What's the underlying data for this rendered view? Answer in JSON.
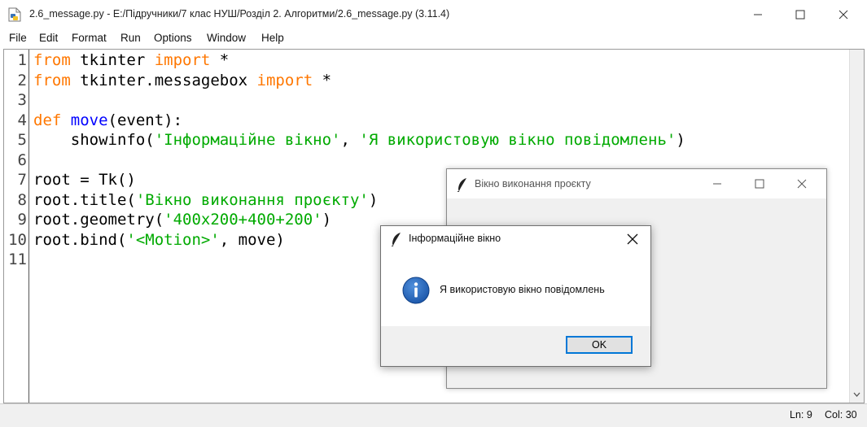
{
  "window": {
    "title": "2.6_message.py - E:/Підручники/7 клас НУШ/Розділ 2. Алгоритми/2.6_message.py (3.11.4)"
  },
  "menu": [
    "File",
    "Edit",
    "Format",
    "Run",
    "Options",
    "Window",
    "Help"
  ],
  "editor": {
    "line_numbers": [
      "1",
      "2",
      "3",
      "4",
      "5",
      "6",
      "7",
      "8",
      "9",
      "10",
      "11"
    ],
    "lines": [
      [
        {
          "t": "from",
          "c": "kw"
        },
        {
          "t": " tkinter ",
          "c": ""
        },
        {
          "t": "import",
          "c": "kw"
        },
        {
          "t": " *",
          "c": ""
        }
      ],
      [
        {
          "t": "from",
          "c": "kw"
        },
        {
          "t": " tkinter.messagebox ",
          "c": ""
        },
        {
          "t": "import",
          "c": "kw"
        },
        {
          "t": " *",
          "c": ""
        }
      ],
      [],
      [
        {
          "t": "def",
          "c": "kw"
        },
        {
          "t": " ",
          "c": ""
        },
        {
          "t": "move",
          "c": "fn"
        },
        {
          "t": "(event):",
          "c": ""
        }
      ],
      [
        {
          "t": "    showinfo(",
          "c": ""
        },
        {
          "t": "'Інформаційне вікно'",
          "c": "str"
        },
        {
          "t": ", ",
          "c": ""
        },
        {
          "t": "'Я використовую вікно повідомлень'",
          "c": "str"
        },
        {
          "t": ")",
          "c": ""
        }
      ],
      [],
      [
        {
          "t": "root = Tk()",
          "c": ""
        }
      ],
      [
        {
          "t": "root.title(",
          "c": ""
        },
        {
          "t": "'Вікно виконання проєкту'",
          "c": "str"
        },
        {
          "t": ")",
          "c": ""
        }
      ],
      [
        {
          "t": "root.geometry(",
          "c": ""
        },
        {
          "t": "'400x200+400+200'",
          "c": "str"
        },
        {
          "t": ")",
          "c": ""
        }
      ],
      [
        {
          "t": "root.bind(",
          "c": ""
        },
        {
          "t": "'<Motion>'",
          "c": "str"
        },
        {
          "t": ", move)",
          "c": ""
        }
      ],
      []
    ]
  },
  "status": {
    "line": "Ln: 9",
    "col": "Col: 30"
  },
  "tk_window": {
    "title": "Вікно виконання проєкту"
  },
  "messagebox": {
    "title": "Інформаційне вікно",
    "message": "Я використовую вікно повідомлень",
    "ok_label": "OK",
    "icon": "info-icon"
  },
  "colors": {
    "keyword": "#ff7700",
    "function": "#0000ff",
    "string": "#00aa00",
    "info_icon": "#1e5fb3",
    "focus_border": "#0078d7"
  }
}
